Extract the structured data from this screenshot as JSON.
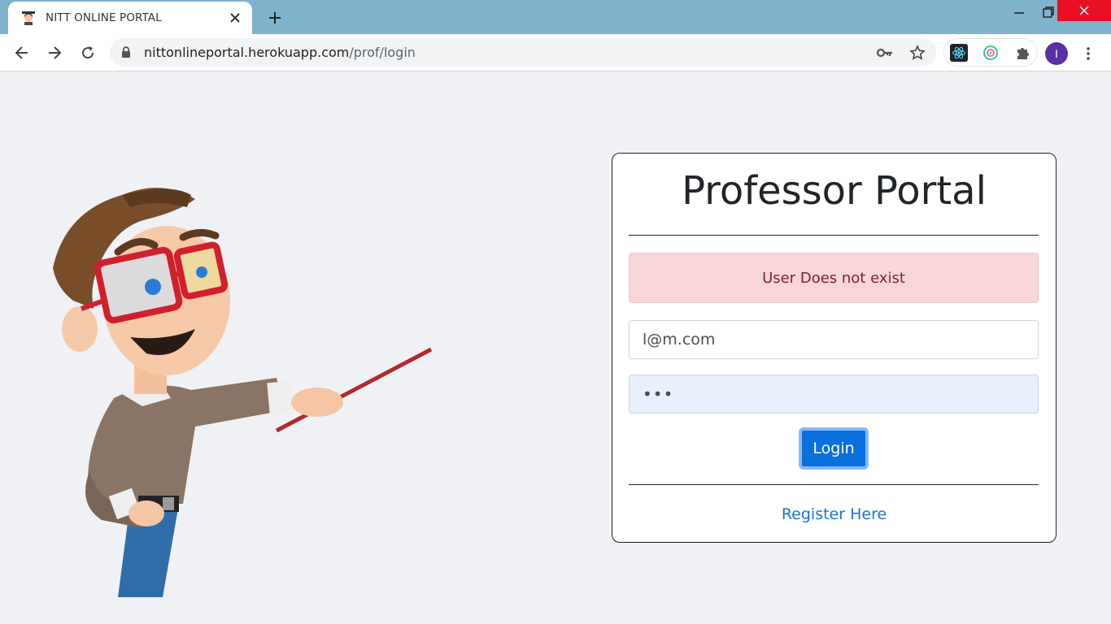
{
  "browser": {
    "tab_title": "NITT ONLINE PORTAL",
    "url_host": "nittonlineportal.herokuapp.com",
    "url_path": "/prof/login",
    "avatar_letter": "I"
  },
  "icons": [
    "teacher-favicon",
    "close-icon",
    "plus-icon",
    "minimize-icon",
    "maximize-icon",
    "window-close-icon",
    "back-icon",
    "forward-icon",
    "reload-icon",
    "lock-icon",
    "key-icon",
    "star-icon",
    "react-devtools-icon",
    "extension-icon",
    "puzzle-icon",
    "kebab-menu-icon"
  ],
  "login": {
    "heading": "Professor Portal",
    "alert": "User Does not exist",
    "email_value": "l@m.com",
    "password_value": "•••",
    "login_label": "Login",
    "register_label": "Register Here"
  },
  "colors": {
    "titlebar": "#7fb3cd",
    "page_bg": "#f0f1f5",
    "alert_bg": "#f8d7da",
    "alert_text": "#842029",
    "primary": "#0b6fdc",
    "link": "#1a73d9"
  }
}
